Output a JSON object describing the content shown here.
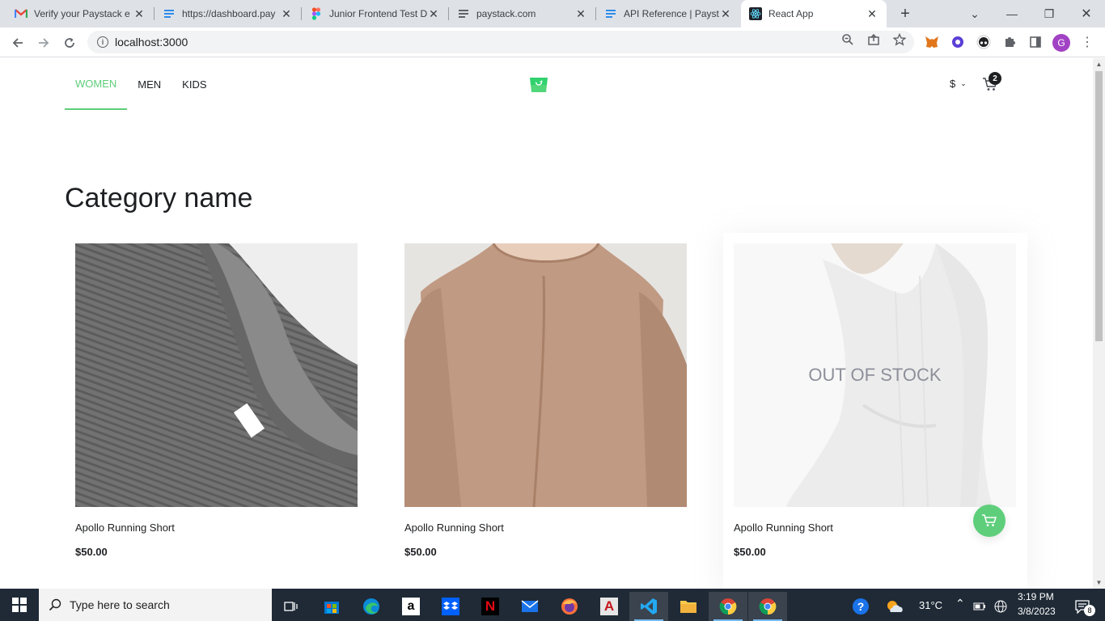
{
  "browser": {
    "tabs": [
      {
        "title": "Verify your Paystack e",
        "icon": "gmail-icon",
        "active": false
      },
      {
        "title": "https://dashboard.pay",
        "icon": "docs-icon",
        "active": false
      },
      {
        "title": "Junior Frontend Test D",
        "icon": "figma-icon",
        "active": false
      },
      {
        "title": "paystack.com",
        "icon": "page-icon",
        "active": false
      },
      {
        "title": "API Reference | Paysta",
        "icon": "docs-icon",
        "active": false
      },
      {
        "title": "React App",
        "icon": "react-icon",
        "active": true
      }
    ],
    "url": "localhost:3000",
    "profile_initial": "G"
  },
  "site": {
    "nav": [
      {
        "label": "WOMEN",
        "active": true
      },
      {
        "label": "MEN",
        "active": false
      },
      {
        "label": "KIDS",
        "active": false
      }
    ],
    "currency_symbol": "$",
    "cart_count": "2",
    "accent_color": "#5ece7b",
    "category_title": "Category name"
  },
  "products": [
    {
      "name": "Apollo Running Short",
      "price": "$50.00",
      "in_stock": true,
      "image": "grey-knit-sweater"
    },
    {
      "name": "Apollo Running Short",
      "price": "$50.00",
      "in_stock": true,
      "image": "beige-sweater-dress"
    },
    {
      "name": "Apollo Running Short",
      "price": "$50.00",
      "in_stock": false,
      "out_of_stock_label": "OUT OF STOCK",
      "image": "white-striped-dress"
    }
  ],
  "taskbar": {
    "search_placeholder": "Type here to search",
    "temperature": "31°C",
    "time": "3:19 PM",
    "date": "3/8/2023",
    "notification_count": "8"
  }
}
